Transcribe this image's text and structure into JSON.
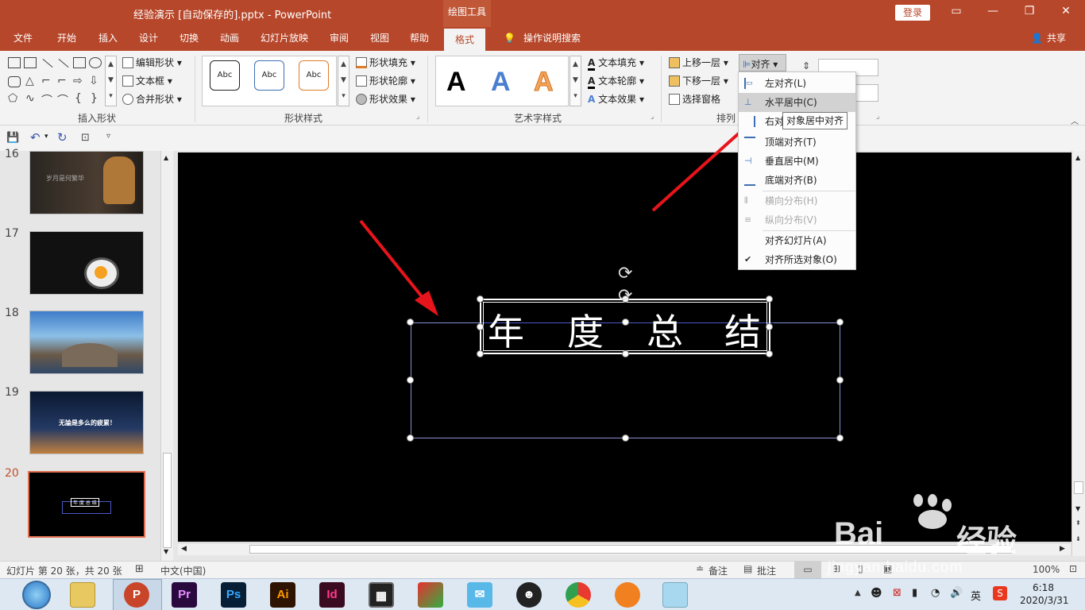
{
  "title": {
    "document": "经验演示 [自动保存的].pptx  -  PowerPoint",
    "contextual_tab": "绘图工具",
    "login": "登录",
    "share": "共享"
  },
  "tabs": [
    "文件",
    "开始",
    "插入",
    "设计",
    "切换",
    "动画",
    "幻灯片放映",
    "审阅",
    "视图",
    "帮助",
    "格式"
  ],
  "tell_me": "操作说明搜索",
  "ribbon": {
    "insert_shapes": {
      "label": "插入形状",
      "edit_shape": "编辑形状",
      "text_box": "文本框",
      "merge_shapes": "合并形状"
    },
    "shape_styles": {
      "label": "形状样式",
      "samples": [
        "Abc",
        "Abc",
        "Abc"
      ],
      "fill": "形状填充",
      "outline": "形状轮廓",
      "effects": "形状效果"
    },
    "wordart_styles": {
      "label": "艺术字样式",
      "letters": [
        "A",
        "A",
        "A"
      ],
      "text_fill": "文本填充",
      "text_outline": "文本轮廓",
      "text_effects": "文本效果"
    },
    "arrange": {
      "label": "排列",
      "bring_forward": "上移一层",
      "send_backward": "下移一层",
      "selection_pane": "选择窗格",
      "align": "对齐"
    }
  },
  "align_menu": {
    "items": [
      {
        "label": "左对齐(L)",
        "enabled": true
      },
      {
        "label": "水平居中(C)",
        "enabled": true,
        "highlighted": true
      },
      {
        "label": "右对",
        "enabled": true
      },
      {
        "label": "顶端对齐(T)",
        "enabled": true
      },
      {
        "label": "垂直居中(M)",
        "enabled": true
      },
      {
        "label": "底端对齐(B)",
        "enabled": true
      },
      {
        "label": "横向分布(H)",
        "enabled": false
      },
      {
        "label": "纵向分布(V)",
        "enabled": false
      },
      {
        "label": "对齐幻灯片(A)",
        "enabled": true
      },
      {
        "label": "对齐所选对象(O)",
        "enabled": true,
        "checked": true
      }
    ],
    "tooltip": "对象居中对齐"
  },
  "slides": [
    {
      "number": "16",
      "caption": "岁月是何繁华"
    },
    {
      "number": "17"
    },
    {
      "number": "18"
    },
    {
      "number": "19",
      "caption": "无論是多么的疲累！"
    },
    {
      "number": "20",
      "selected": true,
      "caption": "年 度 总 结"
    }
  ],
  "slide_text": [
    "年",
    "度",
    "总",
    "结"
  ],
  "status": {
    "slide_info": "幻灯片 第 20 张，共 20 张",
    "language": "中文(中国)",
    "notes": "备注",
    "comments": "批注",
    "zoom": "100%"
  },
  "taskbar": {
    "apps": [
      "Pr",
      "Ps",
      "Ai",
      "Id"
    ],
    "ime": "英",
    "time": "6:18",
    "date": "2020/3/31"
  },
  "watermark": {
    "brand": "Bai",
    "brand2": "经验",
    "url": "jingyan.baidu.com"
  },
  "colors": {
    "accent": "#b7472a",
    "arrow": "#e8141b"
  }
}
